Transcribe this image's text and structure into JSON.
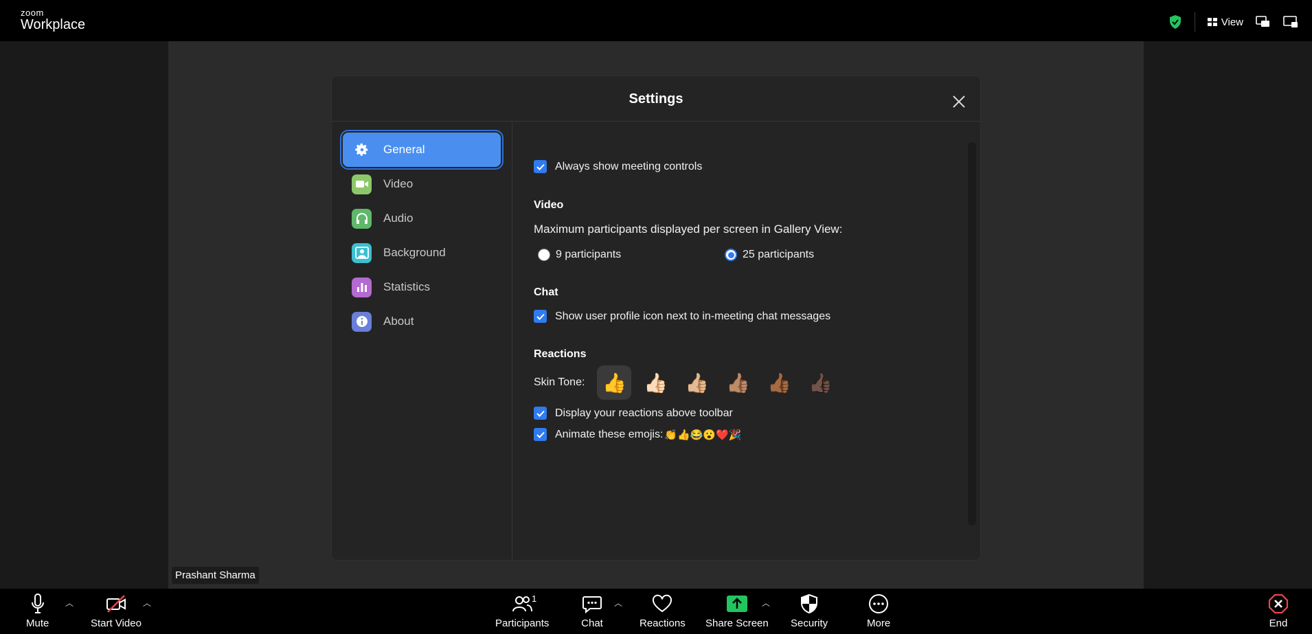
{
  "app": {
    "logo_line1": "zoom",
    "logo_line2": "Workplace",
    "view_label": "View"
  },
  "stage": {
    "participant_name": "Prashant Sharma"
  },
  "settings": {
    "title": "Settings",
    "nav": [
      {
        "label": "General",
        "icon": "gear-icon",
        "color": "#4a8ff0",
        "active": true
      },
      {
        "label": "Video",
        "icon": "video-camera-icon",
        "color": "#8cc86a"
      },
      {
        "label": "Audio",
        "icon": "headphones-icon",
        "color": "#5fb86a"
      },
      {
        "label": "Background",
        "icon": "background-icon",
        "color": "#3cbfd0"
      },
      {
        "label": "Statistics",
        "icon": "statistics-icon",
        "color": "#b46ad0"
      },
      {
        "label": "About",
        "icon": "info-icon",
        "color": "#6a7fd8"
      }
    ],
    "general": {
      "always_show_controls": "Always show meeting controls",
      "video_section": "Video",
      "max_participants_label": "Maximum participants displayed per screen in Gallery View:",
      "option_9": "9 participants",
      "option_25": "25 participants",
      "selected_option": "25 participants",
      "chat_section": "Chat",
      "show_profile_icon": "Show user profile icon next to in-meeting chat messages",
      "reactions_section": "Reactions",
      "skin_tone_label": "Skin Tone:",
      "skin_tones": [
        "👍",
        "👍🏻",
        "👍🏼",
        "👍🏽",
        "👍🏾",
        "👍🏿"
      ],
      "display_reactions": "Display your reactions above toolbar",
      "animate_emojis": "Animate these emojis:",
      "animated_emojis": "👏👍😂😮❤️🎉"
    }
  },
  "toolbar": {
    "mute": "Mute",
    "start_video": "Start Video",
    "participants": "Participants",
    "participant_count": "1",
    "chat": "Chat",
    "reactions": "Reactions",
    "share_screen": "Share Screen",
    "security": "Security",
    "more": "More",
    "end": "End"
  },
  "colors": {
    "accent": "#2f7bf0",
    "share_green": "#22c55e",
    "end_red": "#e5484d"
  }
}
